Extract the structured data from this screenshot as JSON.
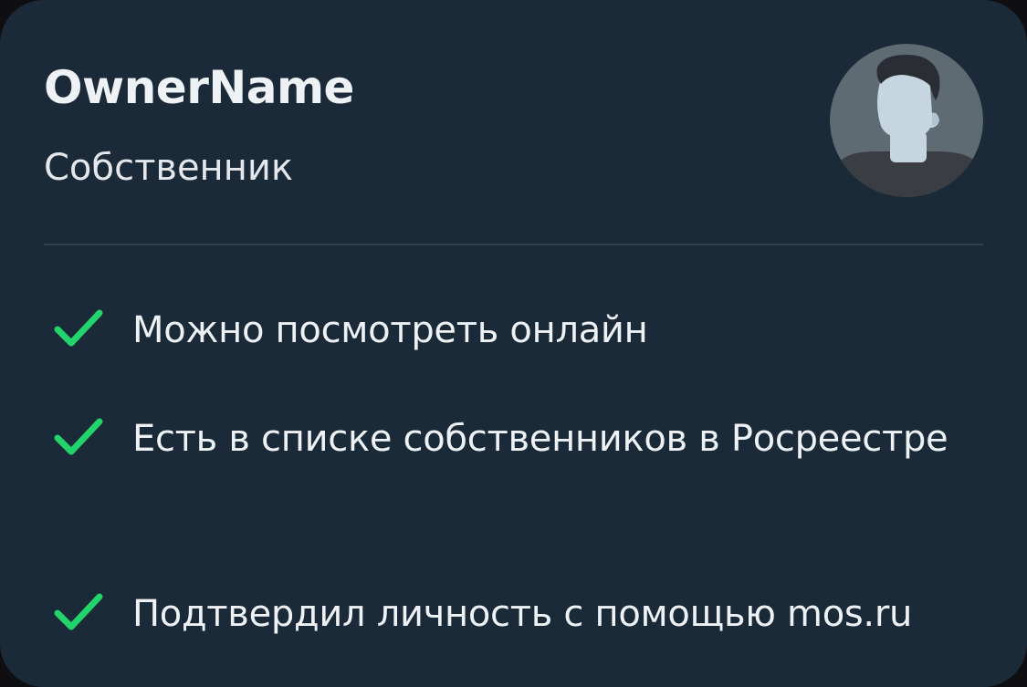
{
  "owner": {
    "name": "OwnerName",
    "role": "Собственник"
  },
  "avatar": {
    "icon": "user-avatar-icon",
    "background_color": "#5e6b73",
    "hair_color": "#2a2d33",
    "skin_color": "#c5d6e1",
    "shirt_color": "#3a3d42"
  },
  "features": [
    {
      "icon": "check-icon",
      "text": "Можно посмотреть онлайн"
    },
    {
      "icon": "check-icon",
      "text": "Есть в списке собственников в Росреестре"
    },
    {
      "icon": "check-icon",
      "text": "Подтвердил личность с помощью mos.ru"
    }
  ],
  "colors": {
    "card_background": "#1a2a39",
    "check_green": "#22d46b",
    "text_primary": "#eef2f5"
  }
}
